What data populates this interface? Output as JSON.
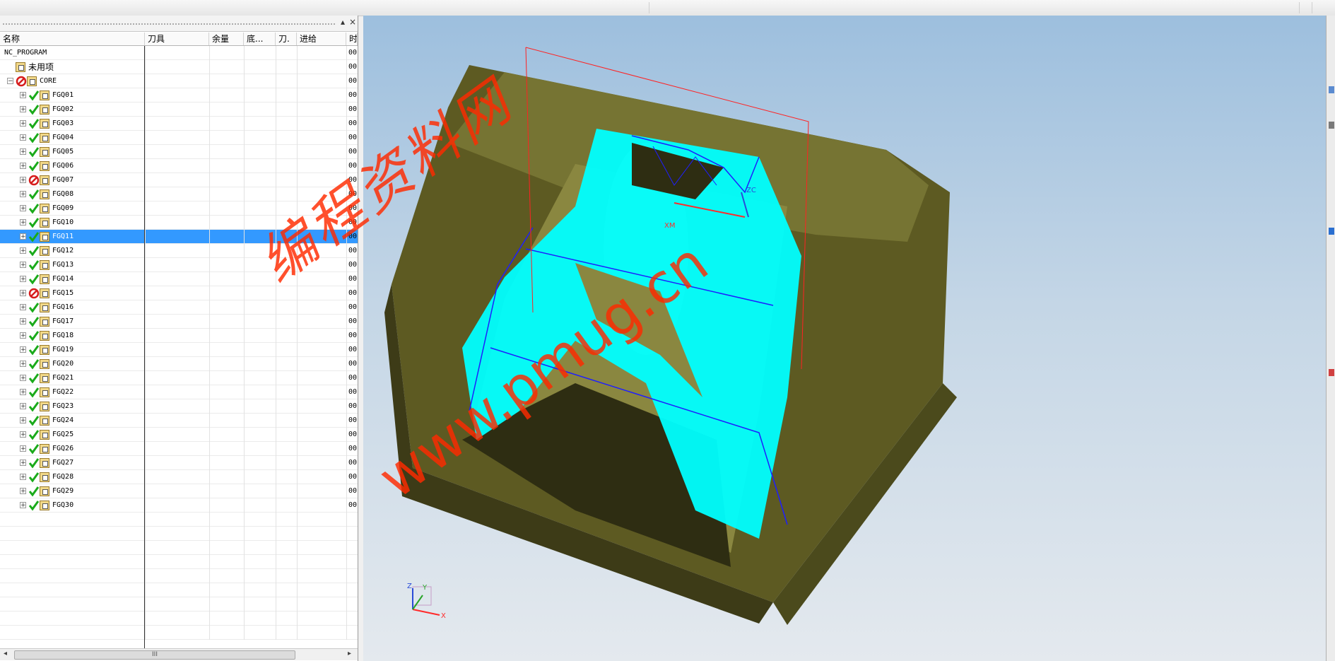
{
  "navigator": {
    "columns": [
      "名称",
      "刀具",
      "余量",
      "底...",
      "刀.",
      "进给",
      "时"
    ],
    "rows": [
      {
        "name": "NC_PROGRAM",
        "level": 0,
        "expander": "",
        "status": "",
        "time": "00"
      },
      {
        "name": "未用项",
        "level": 1,
        "expander": "",
        "status": "",
        "time": "00"
      },
      {
        "name": "CORE",
        "level": 1,
        "expander": "⊟",
        "status": "no",
        "time": "00"
      },
      {
        "name": "FGQ01",
        "level": 2,
        "expander": "+",
        "status": "ok",
        "time": "00"
      },
      {
        "name": "FGQ02",
        "level": 2,
        "expander": "+",
        "status": "ok",
        "time": "00"
      },
      {
        "name": "FGQ03",
        "level": 2,
        "expander": "+",
        "status": "ok",
        "time": "00"
      },
      {
        "name": "FGQ04",
        "level": 2,
        "expander": "+",
        "status": "ok",
        "time": "00"
      },
      {
        "name": "FGQ05",
        "level": 2,
        "expander": "+",
        "status": "ok",
        "time": "00"
      },
      {
        "name": "FGQ06",
        "level": 2,
        "expander": "+",
        "status": "ok",
        "time": "00"
      },
      {
        "name": "FGQ07",
        "level": 2,
        "expander": "+",
        "status": "no",
        "time": "00"
      },
      {
        "name": "FGQ08",
        "level": 2,
        "expander": "+",
        "status": "ok",
        "time": "00"
      },
      {
        "name": "FGQ09",
        "level": 2,
        "expander": "+",
        "status": "ok",
        "time": "00"
      },
      {
        "name": "FGQ10",
        "level": 2,
        "expander": "+",
        "status": "ok",
        "time": "00"
      },
      {
        "name": "FGQ11",
        "level": 2,
        "expander": "+",
        "status": "ok",
        "time": "00",
        "selected": true
      },
      {
        "name": "FGQ12",
        "level": 2,
        "expander": "+",
        "status": "ok",
        "time": "00"
      },
      {
        "name": "FGQ13",
        "level": 2,
        "expander": "+",
        "status": "ok",
        "time": "00"
      },
      {
        "name": "FGQ14",
        "level": 2,
        "expander": "+",
        "status": "ok",
        "time": "00"
      },
      {
        "name": "FGQ15",
        "level": 2,
        "expander": "+",
        "status": "no",
        "time": "00"
      },
      {
        "name": "FGQ16",
        "level": 2,
        "expander": "+",
        "status": "ok",
        "time": "00"
      },
      {
        "name": "FGQ17",
        "level": 2,
        "expander": "+",
        "status": "ok",
        "time": "00"
      },
      {
        "name": "FGQ18",
        "level": 2,
        "expander": "+",
        "status": "ok",
        "time": "00"
      },
      {
        "name": "FGQ19",
        "level": 2,
        "expander": "+",
        "status": "ok",
        "time": "00"
      },
      {
        "name": "FGQ20",
        "level": 2,
        "expander": "+",
        "status": "ok",
        "time": "00"
      },
      {
        "name": "FGQ21",
        "level": 2,
        "expander": "+",
        "status": "ok",
        "time": "00"
      },
      {
        "name": "FGQ22",
        "level": 2,
        "expander": "+",
        "status": "ok",
        "time": "00"
      },
      {
        "name": "FGQ23",
        "level": 2,
        "expander": "+",
        "status": "ok",
        "time": "00"
      },
      {
        "name": "FGQ24",
        "level": 2,
        "expander": "+",
        "status": "ok",
        "time": "00"
      },
      {
        "name": "FGQ25",
        "level": 2,
        "expander": "+",
        "status": "ok",
        "time": "00"
      },
      {
        "name": "FGQ26",
        "level": 2,
        "expander": "+",
        "status": "ok",
        "time": "00"
      },
      {
        "name": "FGQ27",
        "level": 2,
        "expander": "+",
        "status": "ok",
        "time": "00"
      },
      {
        "name": "FGQ28",
        "level": 2,
        "expander": "+",
        "status": "ok",
        "time": "00"
      },
      {
        "name": "FGQ29",
        "level": 2,
        "expander": "+",
        "status": "ok",
        "time": "00"
      },
      {
        "name": "FGQ30",
        "level": 2,
        "expander": "+",
        "status": "ok",
        "time": "00"
      }
    ],
    "empty_rows": 9,
    "header_close": "×",
    "header_pin": "▴",
    "scroll_grip": "III"
  },
  "viewport": {
    "watermark_cn": "编程资料网",
    "watermark_url": "www.pmug.cn",
    "axis_labels": {
      "zc": "ZC",
      "xm": "XM",
      "x": "X",
      "y": "Y",
      "z": "Z"
    }
  },
  "colors": {
    "selection": "#3399ff",
    "toolpath": "#00ffff",
    "part": "#6b6a2a",
    "status_ok": "#1aaa1a",
    "status_no": "#d61c1c",
    "watermark": "#ff2a00"
  },
  "icons": {
    "ok": "checkmark-icon",
    "no": "no-entry-icon",
    "program": "program-group-icon"
  }
}
